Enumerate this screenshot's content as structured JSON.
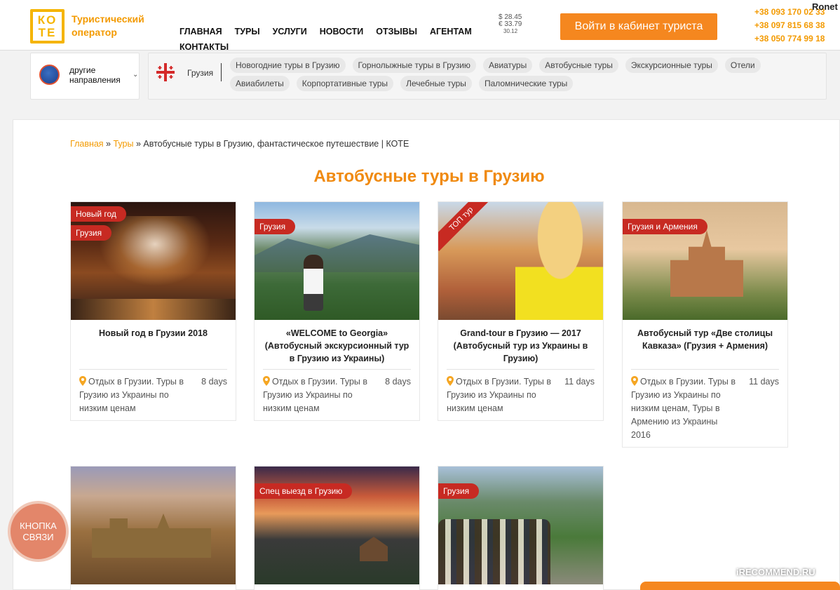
{
  "header": {
    "logo_line1": "КО",
    "logo_line2": "ТЕ",
    "logo_text": "Туристический оператор",
    "nav": [
      "ГЛАВНАЯ",
      "ТУРЫ",
      "УСЛУГИ",
      "НОВОСТИ",
      "ОТЗЫВЫ",
      "АГЕНТАМ",
      "КОНТАКТЫ"
    ],
    "rates": {
      "usd": "$ 28.45",
      "eur": "€ 33.79",
      "date": "30.12"
    },
    "cabinet_button": "Войти в кабинет туриста",
    "phones": [
      "+38 093 170 02 33",
      "+38 097 815 68 38",
      "+38 050 774 99 18"
    ],
    "overlay_user": "Ronet"
  },
  "filters": {
    "destinations_label": "другие направления",
    "country": "Грузия",
    "chips": [
      "Новогодние туры в Грузию",
      "Горнолыжные туры в Грузию",
      "Авиатуры",
      "Автобусные туры",
      "Экскурсионные туры",
      "Отели",
      "Авиабилеты",
      "Корпортативные туры",
      "Лечебные туры",
      "Паломнические туры"
    ]
  },
  "breadcrumb": {
    "home": "Главная",
    "sep1": " » ",
    "tours": "Туры",
    "sep2": " » ",
    "current": "Автобусные туры в Грузию, фантастическое путешествие | КОТЕ"
  },
  "page_title": "Автобусные туры в Грузию",
  "cards": [
    {
      "badges": [
        "Новый год",
        "Грузия"
      ],
      "title": "Новый год в Грузии 2018",
      "location": "Отдых в Грузии. Туры в Грузию из Украины по низким ценам",
      "days": "8 days"
    },
    {
      "badges": [
        "Грузия"
      ],
      "title": "«WELCOME to Georgia» (Автобусный экскурсионный тур в Грузию из Украины)",
      "location": "Отдых в Грузии. Туры в Грузию из Украины по низким ценам",
      "days": "8 days"
    },
    {
      "ribbon": "ТОП тур",
      "title": "Grand-tour в Грузию — 2017 (Автобусный тур из Украины в Грузию)",
      "location": "Отдых в Грузии. Туры в Грузию из Украины по низким ценам",
      "days": "11 days"
    },
    {
      "badges": [
        "Грузия и Армения"
      ],
      "title": "Автобусный тур «Две столицы Кавказа» (Грузия + Армения)",
      "location": "Отдых в Грузии. Туры в Грузию из Украины по низким ценам, Туры в Армению из Украины 2016",
      "days": "11 days"
    },
    {
      "badges": []
    },
    {
      "badges": [
        "Спец выезд в Грузию"
      ]
    },
    {
      "badges": [
        "Грузия"
      ]
    }
  ],
  "contact_button": "КНОПКА СВЯЗИ",
  "watermark": "iRECOMMEND.RU",
  "colors": {
    "accent": "#f5871f",
    "badge": "#c72a22",
    "title": "#f08a10"
  }
}
